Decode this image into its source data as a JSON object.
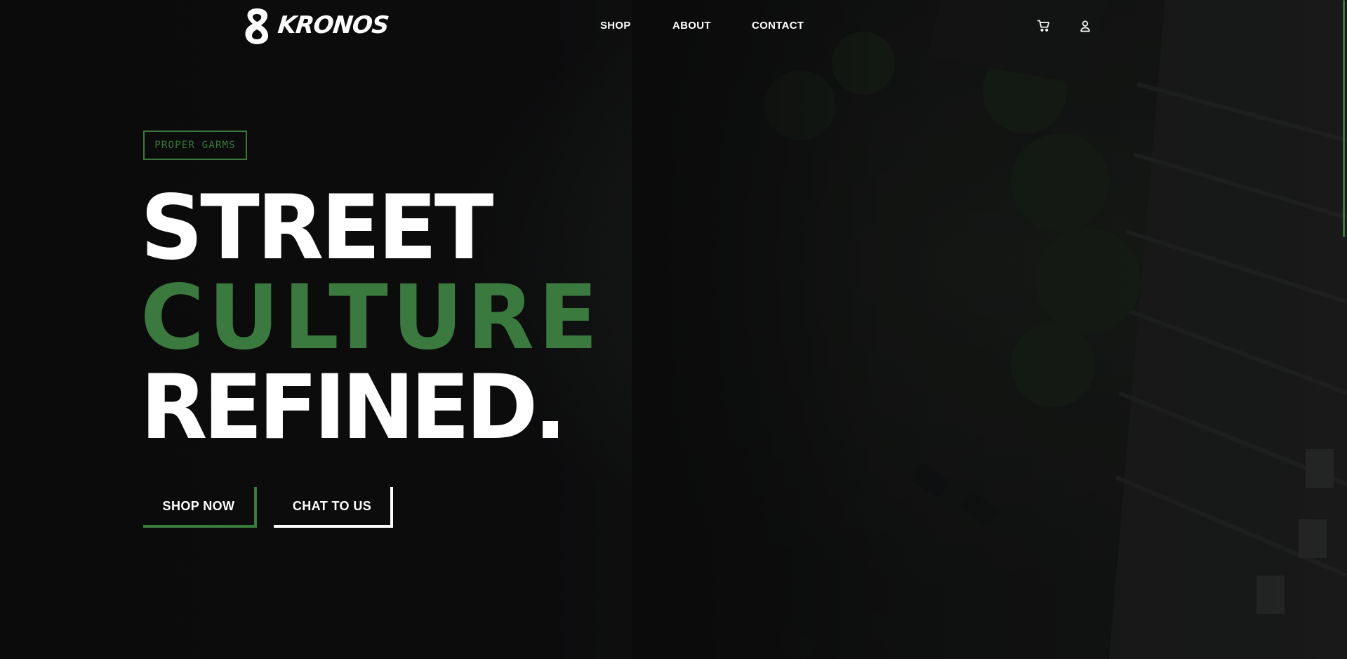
{
  "brand": {
    "logo_text": "KRONOS",
    "logo_icon": "eight-mark-icon"
  },
  "nav": {
    "items": [
      {
        "label": "SHOP"
      },
      {
        "label": "ABOUT"
      },
      {
        "label": "CONTACT"
      }
    ]
  },
  "header_actions": {
    "cart_icon": "cart-icon",
    "account_icon": "user-icon"
  },
  "hero": {
    "badge": "PROPER GARMS",
    "line_1": "STREET",
    "line_2": "CULTURE",
    "line_3": "REFINED.",
    "cta_primary": "SHOP NOW",
    "cta_secondary": "CHAT TO US"
  },
  "colors": {
    "background": "#0b0b0c",
    "accent_green": "#3a7a3e",
    "text": "#ffffff"
  }
}
